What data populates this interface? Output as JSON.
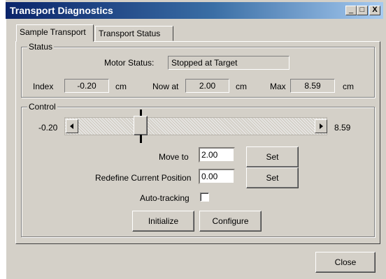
{
  "window": {
    "title": "Transport Diagnostics",
    "title_buttons": {
      "minimize": "_",
      "maximize": "□",
      "close": "X"
    }
  },
  "tabs": [
    {
      "label": "Sample Transport",
      "active": true
    },
    {
      "label": "Transport Status",
      "active": false
    }
  ],
  "status": {
    "group_label": "Status",
    "motor_status_label": "Motor Status:",
    "motor_status_value": "Stopped at Target",
    "index_label": "Index",
    "index_value": "-0.20",
    "now_at_label": "Now at",
    "now_at_value": "2.00",
    "max_label": "Max",
    "max_value": "8.59",
    "unit": "cm"
  },
  "control": {
    "group_label": "Control",
    "slider_min_label": "-0.20",
    "slider_max_label": "8.59",
    "slider": {
      "min": -0.2,
      "max": 8.59,
      "value": 2.0
    },
    "move_to_label": "Move to",
    "move_to_value": "2.00",
    "redefine_label": "Redefine Current Position",
    "redefine_value": "0.00",
    "set_label": "Set",
    "auto_tracking_label": "Auto-tracking",
    "auto_tracking_checked": false,
    "initialize_label": "Initialize",
    "configure_label": "Configure"
  },
  "footer": {
    "close_label": "Close"
  }
}
